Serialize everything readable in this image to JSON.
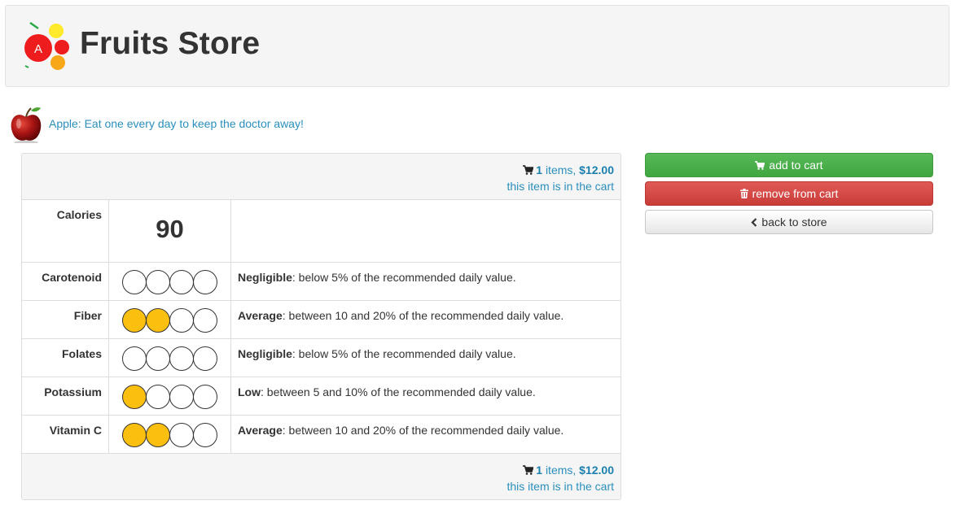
{
  "header": {
    "title": "Fruits Store",
    "logo_letter": "A"
  },
  "product": {
    "name": "Apple",
    "tagline": "Apple: Eat one every day to keep the doctor away!"
  },
  "cart": {
    "count": "1",
    "items_label": "items,",
    "total": "$12.00",
    "status": "this item is in the cart"
  },
  "nutrition": {
    "calories_label": "Calories",
    "calories_value": "90",
    "rows": [
      {
        "label": "Carotenoid",
        "level": 0,
        "max": 4,
        "rating": "Negligible",
        "desc": ": below 5% of the recommended daily value."
      },
      {
        "label": "Fiber",
        "level": 2,
        "max": 4,
        "rating": "Average",
        "desc": ": between 10 and 20% of the recommended daily value."
      },
      {
        "label": "Folates",
        "level": 0,
        "max": 4,
        "rating": "Negligible",
        "desc": ": below 5% of the recommended daily value."
      },
      {
        "label": "Potassium",
        "level": 1,
        "max": 4,
        "rating": "Low",
        "desc": ": between 5 and 10% of the recommended daily value."
      },
      {
        "label": "Vitamin C",
        "level": 2,
        "max": 4,
        "rating": "Average",
        "desc": ": between 10 and 20% of the recommended daily value."
      }
    ],
    "dot_fill_color": "#fbbf10"
  },
  "actions": {
    "add": "add to cart",
    "remove": "remove from cart",
    "back": "back to store"
  },
  "icons": {
    "cart": "cart-icon",
    "trash": "trash-icon",
    "back": "chevron-left-icon"
  },
  "colors": {
    "link": "#2a8fbd",
    "success": "#47a447",
    "danger": "#d2322d",
    "header_bg": "#f5f5f5"
  }
}
